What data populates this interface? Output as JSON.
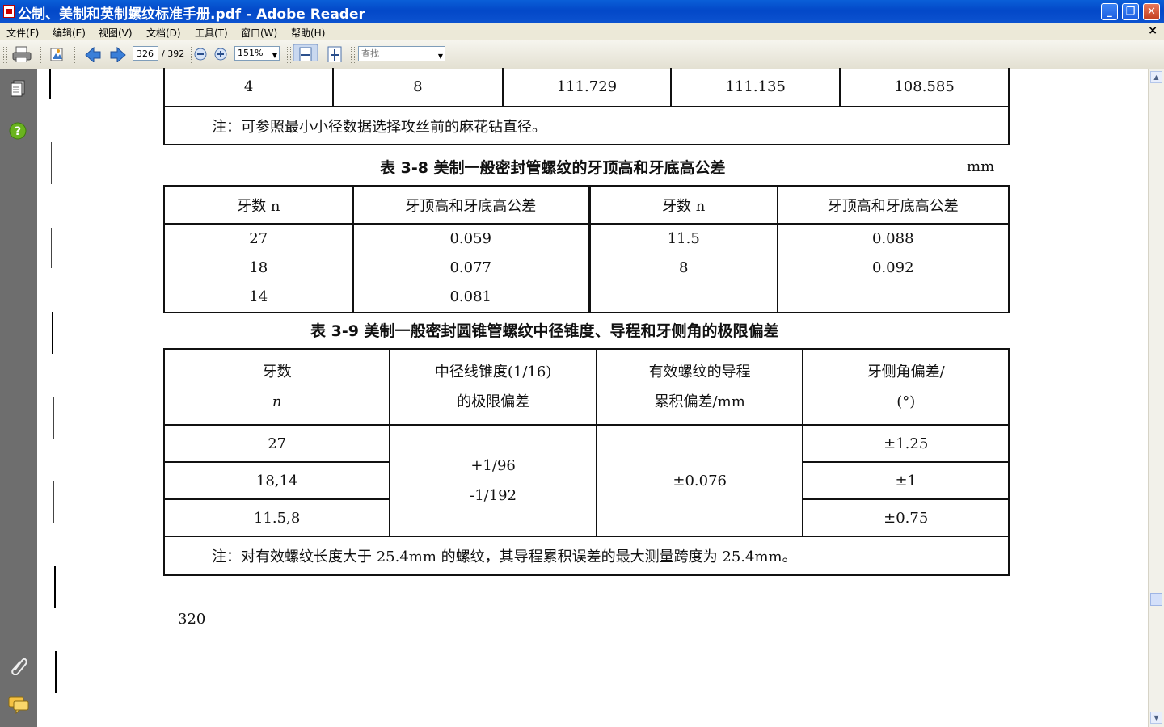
{
  "window": {
    "title": "公制、美制和英制螺纹标准手册.pdf - Adobe Reader"
  },
  "menu": [
    "文件(F)",
    "编辑(E)",
    "视图(V)",
    "文档(D)",
    "工具(T)",
    "窗口(W)",
    "帮助(H)"
  ],
  "toolbar": {
    "current_page": "326",
    "total_pages": "/ 392",
    "zoom": "151%",
    "search_placeholder": "查找"
  },
  "icons": [
    "print-icon",
    "hand-tool-icon",
    "prev-page-icon",
    "next-page-icon",
    "zoom-out-icon",
    "zoom-in-icon",
    "fit-width-icon",
    "fit-page-icon",
    "pages-panel-icon",
    "help-icon",
    "attachments-icon",
    "comments-icon"
  ],
  "document": {
    "top_table": {
      "row": [
        "4",
        "8",
        "111.729",
        "111.135",
        "108.585"
      ],
      "note": "注：可参照最小小径数据选择攻丝前的麻花钻直径。"
    },
    "table38": {
      "caption": "表 3-8   美制一般密封管螺纹的牙顶高和牙底高公差",
      "unit": "mm",
      "headers": [
        "牙数 n",
        "牙顶高和牙底高公差",
        "牙数 n",
        "牙顶高和牙底高公差"
      ],
      "left_n": [
        "27",
        "18",
        "14"
      ],
      "left_tol": [
        "0.059",
        "0.077",
        "0.081"
      ],
      "right_n": [
        "11.5",
        "8"
      ],
      "right_tol": [
        "0.088",
        "0.092"
      ]
    },
    "table39": {
      "caption": "表 3-9   美制一般密封圆锥管螺纹中径锥度、导程和牙侧角的极限偏差",
      "headers": {
        "col1_line1": "牙数",
        "col1_line2": "n",
        "col2_line1": "中径线锥度(1/16)",
        "col2_line2": "的极限偏差",
        "col3_line1": "有效螺纹的导程",
        "col3_line2": "累积偏差/mm",
        "col4_line1": "牙侧角偏差/",
        "col4_line2": "(°)"
      },
      "n_values": [
        "27",
        "18,14",
        "11.5,8"
      ],
      "taper_dev_1": "+1/96",
      "taper_dev_2": "-1/192",
      "lead_dev": "±0.076",
      "flank_dev": [
        "±1.25",
        "±1",
        "±0.75"
      ],
      "note": "注：对有效螺纹长度大于 25.4mm 的螺纹，其导程累积误差的最大测量跨度为 25.4mm。"
    },
    "page_number": "320"
  }
}
